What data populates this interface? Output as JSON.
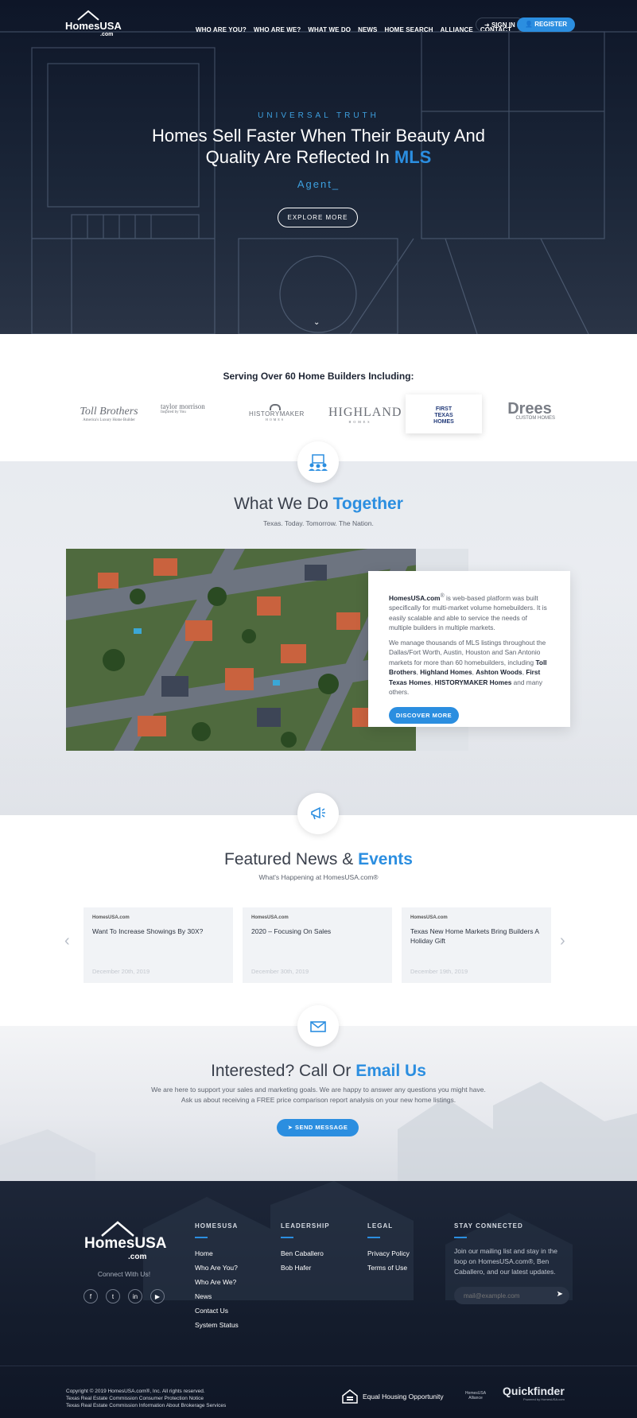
{
  "brand": {
    "logo_main": "HomesUSA",
    "logo_sub": ".com"
  },
  "nav": {
    "items": [
      "WHO ARE YOU?",
      "WHO ARE WE?",
      "WHAT WE DO",
      "NEWS",
      "HOME SEARCH",
      "ALLIANCE",
      "CONTACT"
    ],
    "sign_in": "SIGN IN",
    "register": "REGISTER"
  },
  "hero": {
    "tag": "UNIVERSAL TRUTH",
    "line1": "Homes Sell Faster When Their Beauty And",
    "line2_pre": "Quality Are Reflected In ",
    "line2_hl": "MLS",
    "typed": "Agent_",
    "button": "EXPLORE MORE"
  },
  "builders": {
    "title": "Serving Over 60 Home Builders Including:",
    "logos": [
      "Toll Brothers",
      "taylor morrison",
      "HISTORYMAKER",
      "HIGHLAND",
      "FIRST TEXAS HOMES",
      "Drees"
    ],
    "toll_sub": "America's Luxury Home Builder",
    "taylor_sub": "Inspired by You",
    "history_sub": "HOMES",
    "highland_sub": "HOMES",
    "drees_sub": "CUSTOM HOMES"
  },
  "wwd": {
    "title_pre": "What We Do ",
    "title_hl": "Together",
    "subtitle": "Texas. Today. Tomorrow. The Nation.",
    "p1_brand": "HomesUSA.com",
    "p1_reg": "®",
    "p1_rest": " is web-based platform was built specifically for multi-market volume homebuilders. It is easily scalable and able to service the needs of multiple builders in multiple markets.",
    "p2_pre": "We manage thousands of MLS listings throughout the Dallas/Fort Worth, Austin, Houston and San Antonio markets for more than 60 homebuilders, including ",
    "p2_b1": "Toll Brothers",
    "p2_c1": ", ",
    "p2_b2": "Highland Homes",
    "p2_c2": ", ",
    "p2_b3": "Ashton Woods",
    "p2_c3": ", ",
    "p2_b4": "First Texas Homes",
    "p2_c4": ", ",
    "p2_b5": "HISTORYMAKER Homes",
    "p2_end": " and many others.",
    "button": "DISCOVER MORE"
  },
  "news": {
    "title_pre": "Featured News & ",
    "title_hl": "Events",
    "subtitle": "What's Happening at HomesUSA.com®",
    "items": [
      {
        "title": "Want To Increase Showings By 30X?",
        "date": "December 20th, 2019"
      },
      {
        "title": "2020 – Focusing On Sales",
        "date": "December 30th, 2019"
      },
      {
        "title": "Texas New Home Markets Bring Builders A Holiday Gift",
        "date": "December 19th, 2019"
      }
    ],
    "card_logo": "HomesUSA",
    "card_logo_sub": ".com",
    "prev": "‹",
    "next": "›"
  },
  "contact": {
    "title_pre": "Interested? Call Or ",
    "title_hl": "Email Us",
    "line1": "We are here to support your sales and marketing goals. We are happy to answer any questions you might have.",
    "line2": "Ask us about receiving a FREE price comparison report analysis on your new home listings.",
    "button": "SEND MESSAGE"
  },
  "footer": {
    "tagline": "Connect With Us!",
    "col1": {
      "title": "HOMESUSA",
      "links": [
        "Home",
        "Who Are You?",
        "Who Are We?",
        "News",
        "Contact Us",
        "System Status"
      ]
    },
    "col2": {
      "title": "LEADERSHIP",
      "links": [
        "Ben Caballero",
        "Bob Hafer"
      ]
    },
    "col3": {
      "title": "LEGAL",
      "links": [
        "Privacy Policy",
        "Terms of Use"
      ]
    },
    "col4": {
      "title": "STAY CONNECTED",
      "text": "Join our mailing list and stay in the loop on HomesUSA.com®, Ben Caballero, and our latest updates.",
      "placeholder": "mail@example.com"
    },
    "copyright": "Copyright © 2019 HomesUSA.com®, Inc. All rights reserved.",
    "legal1": "Texas Real Estate Commission Consumer Protection Notice",
    "legal2": "Texas Real Estate Commission Information About Brokerage Services",
    "eho": "Equal Housing Opportunity",
    "realtor": "HomesUSA Alliance",
    "quickfinder": "Quickfinder",
    "quickfinder_sub": "Powered by HomesUSA.com"
  },
  "colors": {
    "accent": "#2b8ee0",
    "navy": "#141c2c"
  }
}
